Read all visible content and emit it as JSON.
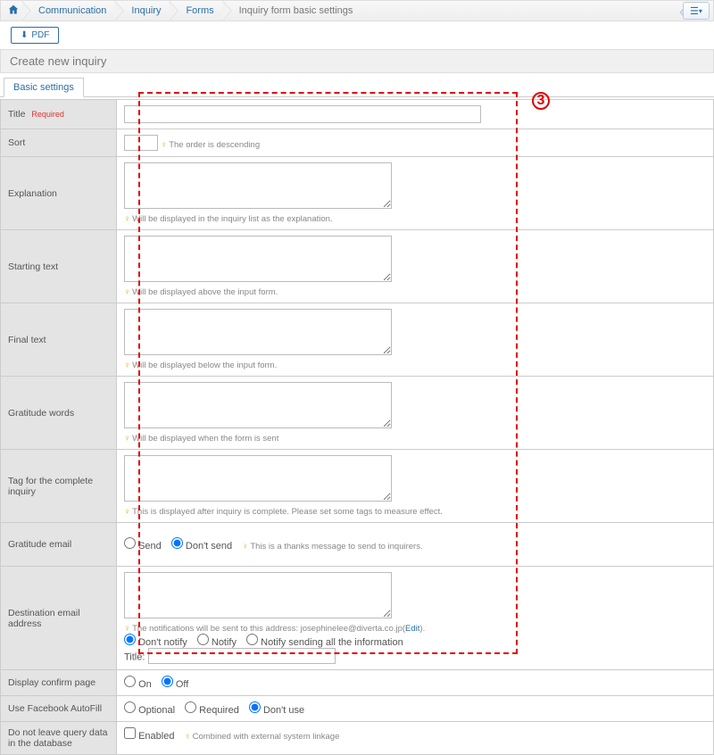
{
  "breadcrumb": {
    "items": [
      "Communication",
      "Inquiry",
      "Forms",
      "Inquiry form basic settings"
    ]
  },
  "pdf_label": "PDF",
  "panel_title": "Create new inquiry",
  "tab_label": "Basic settings",
  "annotation_number": "3",
  "rows": {
    "title": {
      "label": "Title",
      "required": "Required",
      "value": ""
    },
    "sort": {
      "label": "Sort",
      "value": "",
      "hint": "The order is descending"
    },
    "explanation": {
      "label": "Explanation",
      "hint": "Will be displayed in the inquiry list as the explanation."
    },
    "starting_text": {
      "label": "Starting text",
      "hint": "Will be displayed above the input form."
    },
    "final_text": {
      "label": "Final text",
      "hint": "Will be displayed below the input form."
    },
    "gratitude_words": {
      "label": "Gratitude words",
      "hint": "Will be displayed when the form is sent"
    },
    "tag_complete": {
      "label": "Tag for the complete inquiry",
      "hint": "This is displayed after inquiry is complete. Please set some tags to measure effect."
    },
    "gratitude_email": {
      "label": "Gratitude email",
      "opt_send": "Send",
      "opt_dont": "Don't send",
      "hint": "This is a thanks message to send to inquirers."
    },
    "dest_email": {
      "label": "Destination email address",
      "hint_prefix": "The notifications will be sent to this address: ",
      "hint_email": "josephinelee@diverta.co.jp",
      "edit": "Edit",
      "opt_dont_notify": "Don't notify",
      "opt_notify": "Notify",
      "opt_notify_all": "Notify sending all the information",
      "title_label": "Title:",
      "title_value": ""
    },
    "confirm": {
      "label": "Display confirm page",
      "on": "On",
      "off": "Off"
    },
    "fb_autofill": {
      "label": "Use Facebook AutoFill",
      "optional": "Optional",
      "required": "Required",
      "dont_use": "Don't use"
    },
    "no_store": {
      "label": "Do not leave query data in the database",
      "enabled": "Enabled",
      "hint": "Combined with external system linkage"
    }
  }
}
